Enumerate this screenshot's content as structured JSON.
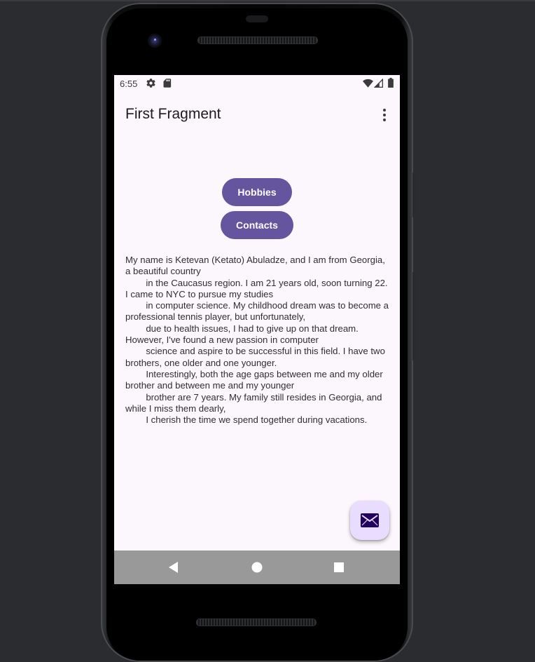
{
  "status_bar": {
    "time": "6:55",
    "left_icons": [
      "settings-gear-icon",
      "sd-card-icon"
    ],
    "right_icons": [
      "wifi-icon",
      "cell-signal-icon",
      "battery-icon"
    ]
  },
  "app_bar": {
    "title": "First Fragment",
    "overflow_icon": "more-vert-icon"
  },
  "buttons": {
    "hobbies_label": "Hobbies",
    "contacts_label": "Contacts"
  },
  "bio_text": "My name is Ketevan (Ketato) Abuladze, and I am from Georgia, a beautiful country\n        in the Caucasus region. I am 21 years old, soon turning 22. I came to NYC to pursue my studies\n        in computer science. My childhood dream was to become a professional tennis player, but unfortunately,\n        due to health issues, I had to give up on that dream. However, I've found a new passion in computer\n        science and aspire to be successful in this field. I have two brothers, one older and one younger.\n        Interestingly, both the age gaps between me and my older brother and between me and my younger\n        brother are 7 years. My family still resides in Georgia, and while I miss them dearly,\n        I cherish the time we spend together during vacations.",
  "fab": {
    "icon": "email-icon"
  },
  "nav_bar": {
    "icons": [
      "back-icon",
      "home-icon",
      "recents-icon"
    ]
  },
  "colors": {
    "primary": "#65559f",
    "screen_background": "#fcf7fc",
    "fab_background": "#e9ddff",
    "fab_icon": "#21005d",
    "nav_bar": "#999999"
  }
}
